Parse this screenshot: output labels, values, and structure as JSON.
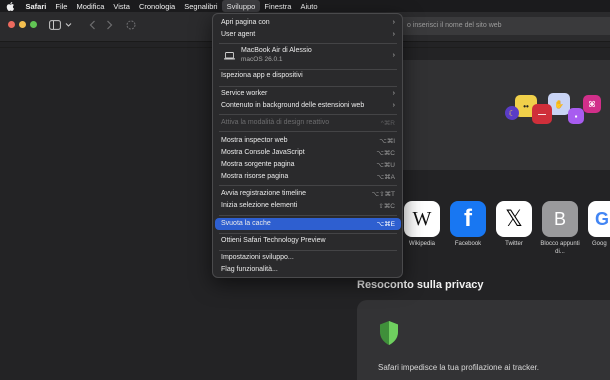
{
  "menubar": {
    "apple_icon": "apple-logo",
    "items": [
      "Safari",
      "File",
      "Modifica",
      "Vista",
      "Cronologia",
      "Segnalibri",
      "Sviluppo",
      "Finestra",
      "Aiuto"
    ],
    "active_item": "Sviluppo"
  },
  "toolbar": {
    "url_placeholder": "o inserisci il nome del sito web",
    "traffic_lights": [
      "#ec6a5e",
      "#f4bf4f",
      "#61c554"
    ]
  },
  "menu": {
    "open_page_with": "Apri pagina con",
    "user_agent": "User agent",
    "device_name": "MacBook Air di Alessio",
    "device_os": "macOS 26.0.1",
    "inspect_apps": "Ispeziona app e dispositivi",
    "service_worker": "Service worker",
    "background_content": "Contenuto in background delle estensioni web",
    "design_mode": "Attiva la modalità di design reattivo",
    "design_mode_shortcut": "^⌘R",
    "web_inspector": "Mostra inspector web",
    "web_inspector_shortcut": "⌥⌘I",
    "js_console": "Mostra Console JavaScript",
    "js_console_shortcut": "⌥⌘C",
    "page_source": "Mostra sorgente pagina",
    "page_source_shortcut": "⌥⌘U",
    "page_resources": "Mostra risorse pagina",
    "page_resources_shortcut": "⌥⌘A",
    "timeline": "Avvia registrazione timeline",
    "timeline_shortcut": "⌥⇧⌘T",
    "select_element": "Inizia selezione elementi",
    "select_element_shortcut": "⇧⌘C",
    "empty_cache": "Svuota la cache",
    "empty_cache_shortcut": "⌥⌘E",
    "tech_preview": "Ottieni Safari Technology Preview",
    "dev_settings": "Impostazioni sviluppo...",
    "feature_flags": "Flag funzionalità..."
  },
  "favorites": [
    {
      "label": "Wikipedia",
      "glyph": "W",
      "color": "#ffffff",
      "icon": "wikipedia-icon"
    },
    {
      "label": "Facebook",
      "glyph": "f",
      "color": "#1877f2",
      "icon": "facebook-icon"
    },
    {
      "label": "Twitter",
      "glyph": "𝕏",
      "color": "#ffffff",
      "icon": "x-twitter-icon"
    },
    {
      "label": "Blocco appunti di...",
      "glyph": "B",
      "color": "#9a9a9c",
      "icon": "letter-b-icon"
    },
    {
      "label": "Goog",
      "glyph": "G",
      "color": "#ffffff",
      "icon": "google-icon"
    }
  ],
  "privacy": {
    "title": "Resoconto sulla privacy",
    "text": "Safari impedisce la tua profilazione ai tracker."
  }
}
